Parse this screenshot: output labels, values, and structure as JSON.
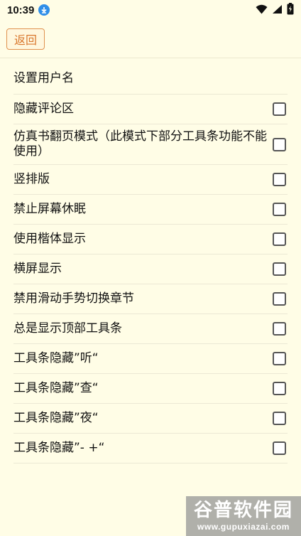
{
  "status_bar": {
    "time": "10:39"
  },
  "toolbar": {
    "back_label": "返回"
  },
  "settings": [
    {
      "label": "设置用户名",
      "has_checkbox": false,
      "checked": false
    },
    {
      "label": "隐藏评论区",
      "has_checkbox": true,
      "checked": false
    },
    {
      "label": "仿真书翻页模式（此模式下部分工具条功能不能使用）",
      "has_checkbox": true,
      "checked": false
    },
    {
      "label": "竖排版",
      "has_checkbox": true,
      "checked": false
    },
    {
      "label": "禁止屏幕休眠",
      "has_checkbox": true,
      "checked": false
    },
    {
      "label": "使用楷体显示",
      "has_checkbox": true,
      "checked": false
    },
    {
      "label": "横屏显示",
      "has_checkbox": true,
      "checked": false
    },
    {
      "label": "禁用滑动手势切换章节",
      "has_checkbox": true,
      "checked": false
    },
    {
      "label": "总是显示顶部工具条",
      "has_checkbox": true,
      "checked": false
    },
    {
      "label": "工具条隐藏”听“",
      "has_checkbox": true,
      "checked": false
    },
    {
      "label": "工具条隐藏”查“",
      "has_checkbox": true,
      "checked": false
    },
    {
      "label": "工具条隐藏”夜“",
      "has_checkbox": true,
      "checked": false
    },
    {
      "label": "工具条隐藏”- +“",
      "has_checkbox": true,
      "checked": false
    }
  ],
  "watermark": {
    "title": "谷普软件园",
    "url": "www.gupuxiazai.com"
  }
}
